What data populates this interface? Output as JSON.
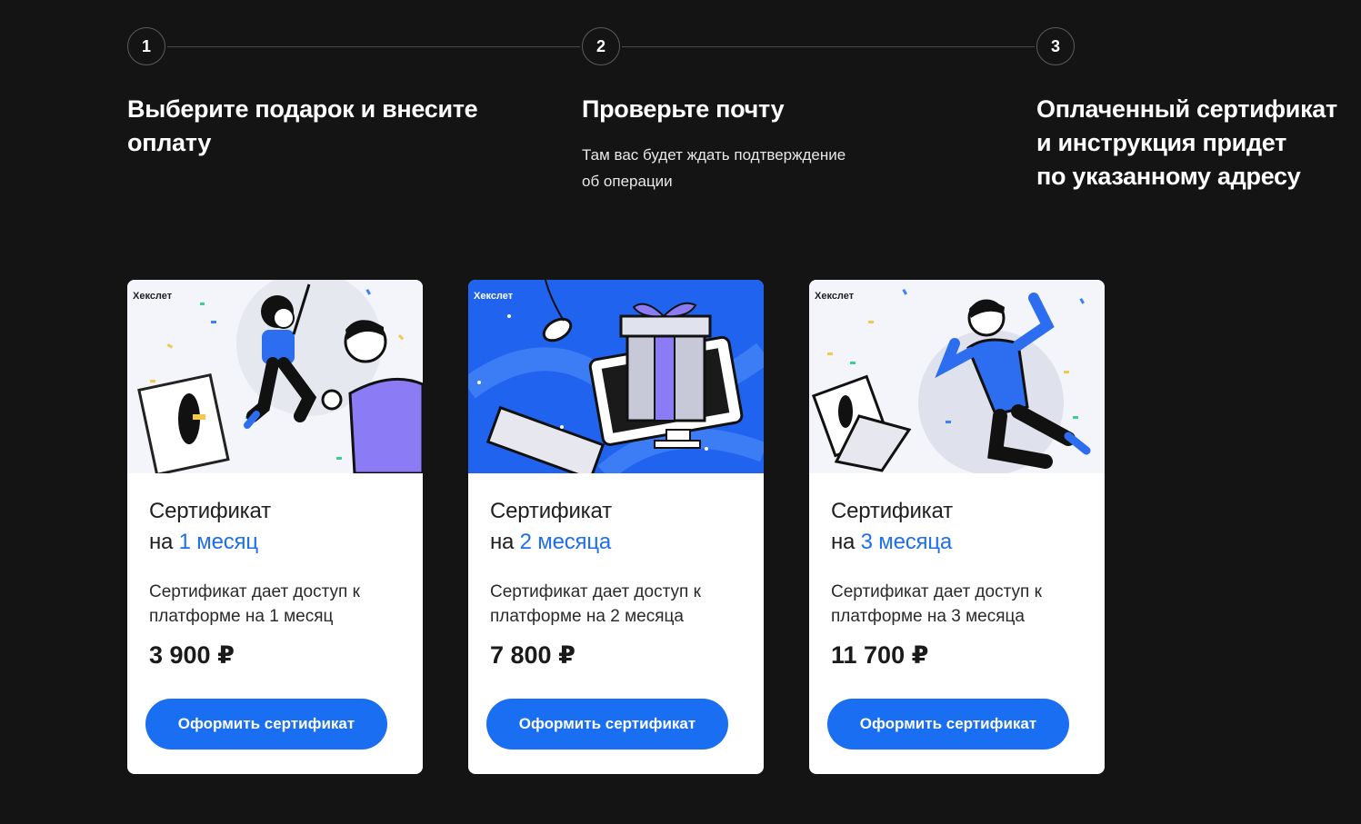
{
  "steps": [
    {
      "number": "1",
      "title": "Выберите подарок и внесите\nоплату",
      "description": ""
    },
    {
      "number": "2",
      "title": "Проверьте почту",
      "description": "Там вас будет ждать подтверждение\nоб операции"
    },
    {
      "number": "3",
      "title": "Оплаченный сертификат\nи инструкция придет\nпо указанному адресу",
      "description": ""
    }
  ],
  "cards": [
    {
      "brand": "Хекслет",
      "title_line1": "Сертификат",
      "title_prefix": "на ",
      "title_accent": "1 месяц",
      "description": "Сертификат дает доступ к платформе на 1 месяц",
      "price": "3 900 ₽",
      "button": "Оформить сертификат"
    },
    {
      "brand": "Хекслет",
      "title_line1": "Сертификат",
      "title_prefix": "на ",
      "title_accent": "2 месяца",
      "description": "Сертификат дает доступ к платформе на 2 месяца",
      "price": "7 800 ₽",
      "button": "Оформить сертификат"
    },
    {
      "brand": "Хекслет",
      "title_line1": "Сертификат",
      "title_prefix": "на ",
      "title_accent": "3 месяца",
      "description": "Сертификат дает доступ к платформе на 3 месяца",
      "price": "11 700 ₽",
      "button": "Оформить сертификат"
    }
  ],
  "colors": {
    "background": "#141414",
    "accent": "#1a6ef1",
    "card": "#ffffff"
  }
}
